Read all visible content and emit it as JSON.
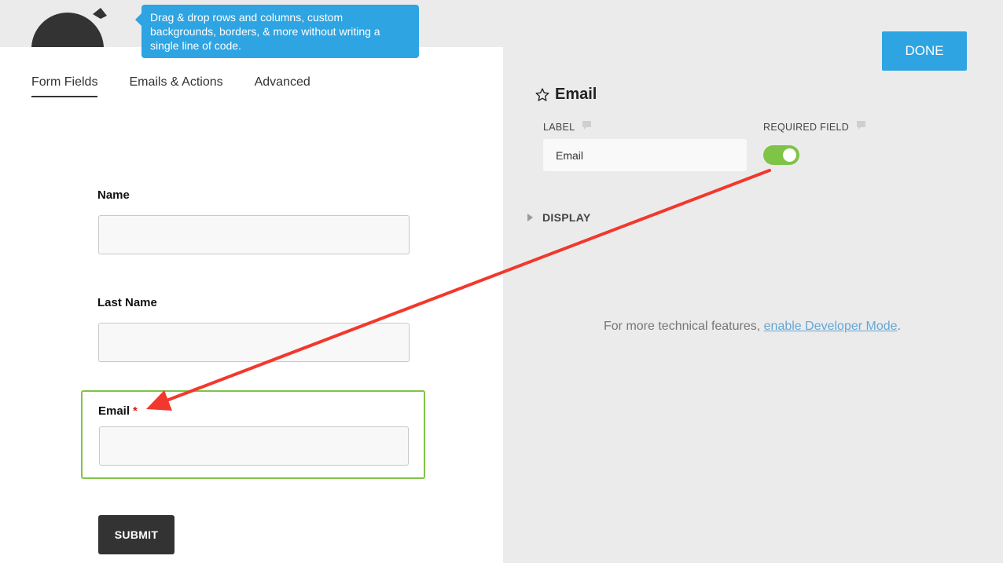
{
  "tooltip": {
    "text": "Drag & drop rows and columns, custom backgrounds, borders, & more without writing a single line of code."
  },
  "tabs": [
    {
      "label": "Form Fields",
      "active": true
    },
    {
      "label": "Emails & Actions",
      "active": false
    },
    {
      "label": "Advanced",
      "active": false
    }
  ],
  "form": {
    "fields": [
      {
        "label": "Name",
        "required": false
      },
      {
        "label": "Last Name",
        "required": false
      },
      {
        "label": "Email",
        "required": true,
        "required_mark": "*"
      }
    ],
    "submit_label": "SUBMIT"
  },
  "toolbar": {
    "done_label": "DONE"
  },
  "settings": {
    "title": "Email",
    "label_heading": "LABEL",
    "label_value": "Email",
    "required_heading": "REQUIRED FIELD",
    "required_on": true,
    "display_heading": "DISPLAY",
    "dev_note_prefix": "For more technical features, ",
    "dev_note_link": "enable Developer Mode",
    "dev_note_suffix": "."
  },
  "colors": {
    "accent_blue": "#2ea4e2",
    "active_green": "#7fc446",
    "arrow_red": "#f2382c",
    "submit_dark": "#333333"
  }
}
